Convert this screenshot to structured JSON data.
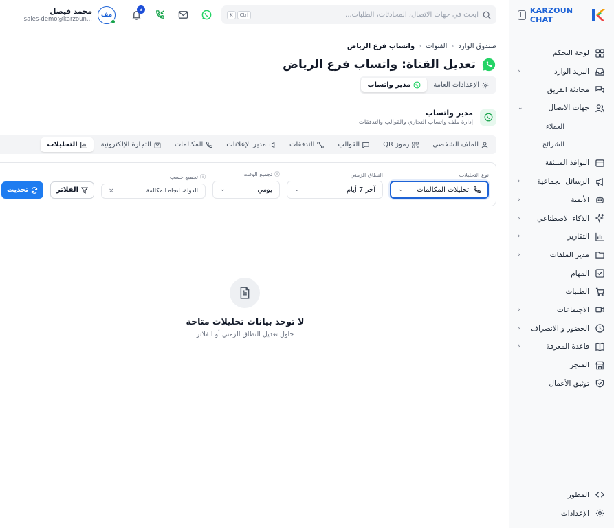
{
  "brand": {
    "name": "KARZOUN CHAT",
    "accent": "#1e63d6",
    "whatsapp_color": "#25d366"
  },
  "sidebar": {
    "items": [
      {
        "label": "لوحة التحكم",
        "icon": "dashboard-icon",
        "chevron": false
      },
      {
        "label": "البريد الوارد",
        "icon": "inbox-icon",
        "chevron": true
      },
      {
        "label": "محادثة الفريق",
        "icon": "team-chat-icon",
        "chevron": false
      },
      {
        "label": "جهات الاتصال",
        "icon": "contacts-icon",
        "chevron": true,
        "expanded": true
      }
    ],
    "subitems": [
      "العملاء",
      "الشرائح"
    ],
    "items2": [
      {
        "label": "النوافذ المنبثقة",
        "icon": "popup-icon",
        "chevron": false
      },
      {
        "label": "الرسائل الجماعية",
        "icon": "megaphone-icon",
        "chevron": true
      },
      {
        "label": "الأتمتة",
        "icon": "bot-icon",
        "chevron": true
      },
      {
        "label": "الذكاء الاصطناعي",
        "icon": "sparkles-icon",
        "chevron": true
      },
      {
        "label": "التقارير",
        "icon": "bar-chart-icon",
        "chevron": true
      },
      {
        "label": "مدير الملفات",
        "icon": "folder-icon",
        "chevron": true
      },
      {
        "label": "المهام",
        "icon": "checkbox-icon",
        "chevron": false
      },
      {
        "label": "الطلبات",
        "icon": "cart-icon",
        "chevron": false
      },
      {
        "label": "الاجتماعات",
        "icon": "video-icon",
        "chevron": true
      },
      {
        "label": "الحضور و الانصراف",
        "icon": "clock-icon",
        "chevron": true
      },
      {
        "label": "قاعدة المعرفة",
        "icon": "book-icon",
        "chevron": true
      },
      {
        "label": "المتجر",
        "icon": "store-icon",
        "chevron": false
      },
      {
        "label": "توثيق الأعمال",
        "icon": "shield-check-icon",
        "chevron": false
      }
    ],
    "bottom": [
      {
        "label": "المطور",
        "icon": "code-icon"
      },
      {
        "label": "الإعدادات",
        "icon": "gear-icon"
      }
    ]
  },
  "topbar": {
    "search_placeholder": "ابحث في جهات الاتصال، المحادثات، الطلبات...",
    "shortcut_keys": [
      "Ctrl",
      "K"
    ],
    "notification_count": "3",
    "user": {
      "name": "محمد فيصل",
      "email": "sales-demo@karzoun...",
      "initials": "مف"
    }
  },
  "breadcrumb": [
    "صندوق الوارد",
    "القنوات",
    "واتساب فرع الرياض"
  ],
  "page_title": "تعديل القناة: واتساب فرع الرياض",
  "subtabs": [
    {
      "label": "الإعدادات العامة",
      "icon": "gear-icon",
      "active": false
    },
    {
      "label": "مدير واتساب",
      "icon": "whatsapp-icon",
      "active": true
    }
  ],
  "card": {
    "title": "مدير واتساب",
    "subtitle": "إدارة ملف واتساب التجاري والقوالب والتدفقات"
  },
  "tabs": [
    {
      "label": "الملف الشخصي",
      "icon": "user-icon",
      "active": false
    },
    {
      "label": "رموز QR",
      "icon": "qr-icon",
      "active": false
    },
    {
      "label": "القوالب",
      "icon": "message-icon",
      "active": false
    },
    {
      "label": "التدفقات",
      "icon": "flow-icon",
      "active": false
    },
    {
      "label": "مدير الإعلانات",
      "icon": "megaphone-icon",
      "active": false
    },
    {
      "label": "المكالمات",
      "icon": "phone-icon",
      "active": false
    },
    {
      "label": "التجارة الإلكترونية",
      "icon": "shop-icon",
      "active": false
    },
    {
      "label": "التحليلات",
      "icon": "bar-chart-icon",
      "active": true
    }
  ],
  "filters": {
    "analytics_type": {
      "label": "نوع التحليلات",
      "value": "تحليلات المكالمات"
    },
    "time_range": {
      "label": "النطاق الزمني",
      "value": "آخر 7 أيام"
    },
    "time_group": {
      "label": "تجميع الوقت",
      "value": "يومي"
    },
    "group_by": {
      "label": "تجميع حسب",
      "value": "الدولة، اتجاه المكالمة"
    },
    "filters_button": "الفلاتر",
    "refresh_button": "تحديث"
  },
  "empty_state": {
    "title": "لا توجد بيانات تحليلات متاحة",
    "subtitle": "حاول تعديل النطاق الزمني أو الفلاتر"
  }
}
